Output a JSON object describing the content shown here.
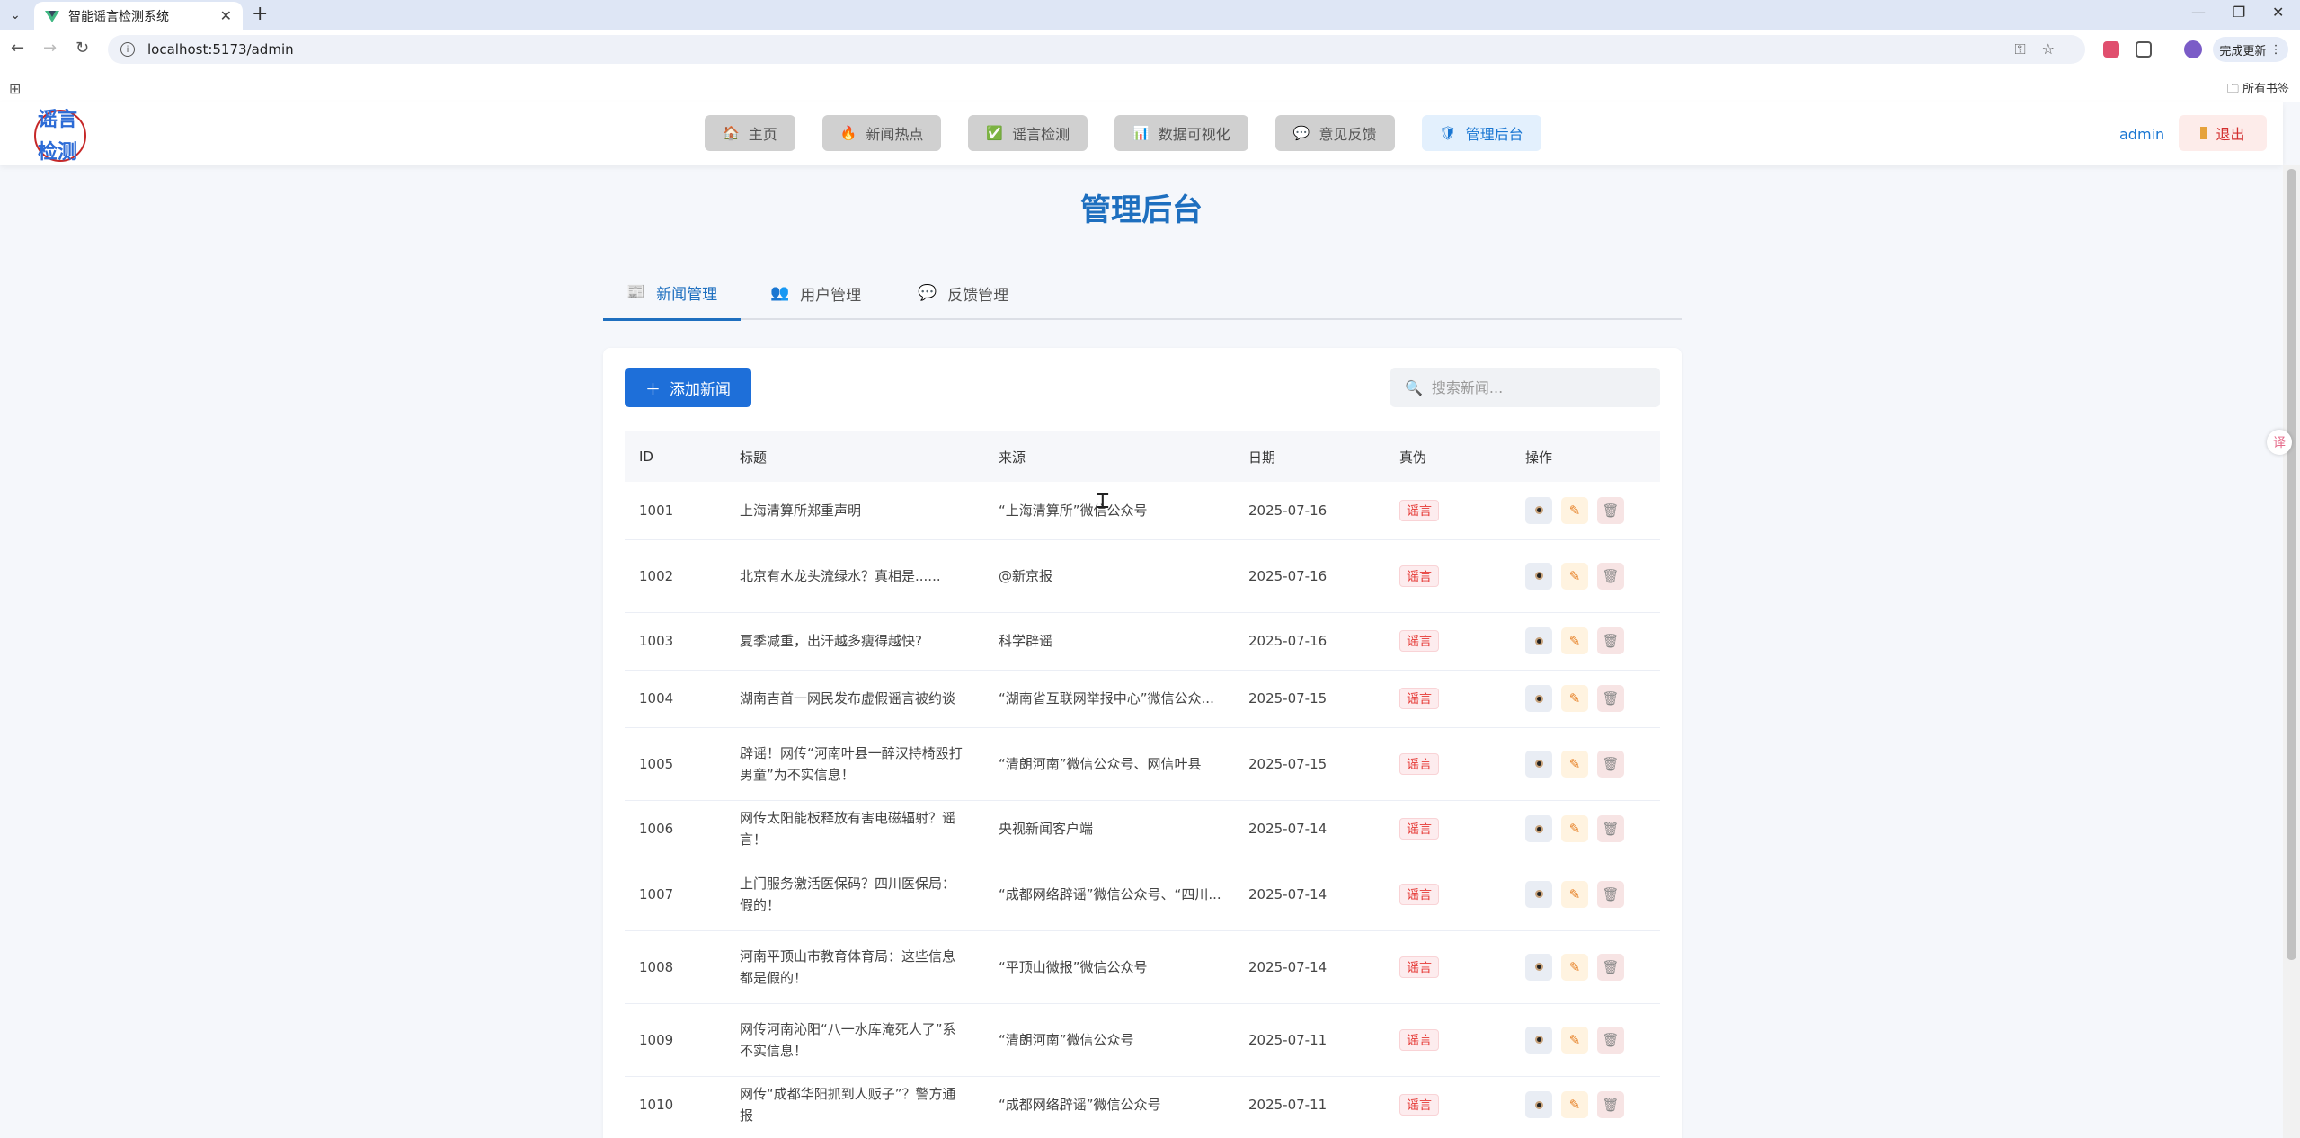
{
  "browser": {
    "tab_title": "智能谣言检测系统",
    "url": "localhost:5173/admin",
    "update_label": "完成更新",
    "all_bookmarks": "所有书签"
  },
  "header": {
    "logo_text": "谣言检测",
    "nav": [
      {
        "label": "主页",
        "icon": "home-icon",
        "glyph": "🏠"
      },
      {
        "label": "新闻热点",
        "icon": "fire-icon",
        "glyph": "🔥"
      },
      {
        "label": "谣言检测",
        "icon": "check-icon",
        "glyph": "✅"
      },
      {
        "label": "数据可视化",
        "icon": "chart-icon",
        "glyph": "📊"
      },
      {
        "label": "意见反馈",
        "icon": "speech-icon",
        "glyph": "💬"
      },
      {
        "label": "管理后台",
        "icon": "shield-icon",
        "glyph": "🛡"
      }
    ],
    "user": "admin",
    "logout": "退出"
  },
  "page": {
    "title": "管理后台",
    "tabs": [
      {
        "label": "新闻管理",
        "glyph": "📰"
      },
      {
        "label": "用户管理",
        "glyph": "👥"
      },
      {
        "label": "反馈管理",
        "glyph": "💬"
      }
    ],
    "add_button": "添加新闻",
    "search_placeholder": "搜索新闻..."
  },
  "table": {
    "headers": [
      "ID",
      "标题",
      "来源",
      "日期",
      "真伪",
      "操作"
    ],
    "rows": [
      {
        "id": "1001",
        "title": "上海清算所郑重声明",
        "source": "“上海清算所”微信公众号",
        "date": "2025-07-16",
        "verdict": "谣言"
      },
      {
        "id": "1002",
        "title": "北京有水龙头流绿水？真相是......",
        "source": "@新京报",
        "date": "2025-07-16",
        "verdict": "谣言"
      },
      {
        "id": "1003",
        "title": "夏季减重，出汗越多瘦得越快?",
        "source": "科学辟谣",
        "date": "2025-07-16",
        "verdict": "谣言"
      },
      {
        "id": "1004",
        "title": "湖南吉首一网民发布虚假谣言被约谈",
        "source": "“湖南省互联网举报中心”微信公众...",
        "date": "2025-07-15",
        "verdict": "谣言"
      },
      {
        "id": "1005",
        "title": "辟谣！网传“河南叶县一醉汉持椅殴打男童”为不实信息！",
        "source": "“清朗河南”微信公众号、网信叶县",
        "date": "2025-07-15",
        "verdict": "谣言"
      },
      {
        "id": "1006",
        "title": "网传太阳能板释放有害电磁辐射？谣言！",
        "source": "央视新闻客户端",
        "date": "2025-07-14",
        "verdict": "谣言"
      },
      {
        "id": "1007",
        "title": "上门服务激活医保码？四川医保局：假的！",
        "source": "“成都网络辟谣”微信公众号、“四川...",
        "date": "2025-07-14",
        "verdict": "谣言"
      },
      {
        "id": "1008",
        "title": "河南平顶山市教育体育局：这些信息都是假的！",
        "source": "“平顶山微报”微信公众号",
        "date": "2025-07-14",
        "verdict": "谣言"
      },
      {
        "id": "1009",
        "title": "网传河南沁阳“八一水库淹死人了”系不实信息！",
        "source": "“清朗河南”微信公众号",
        "date": "2025-07-11",
        "verdict": "谣言"
      },
      {
        "id": "1010",
        "title": "网传“成都华阳抓到人贩子”？警方通报",
        "source": "“成都网络辟谣”微信公众号",
        "date": "2025-07-11",
        "verdict": "谣言"
      }
    ]
  }
}
